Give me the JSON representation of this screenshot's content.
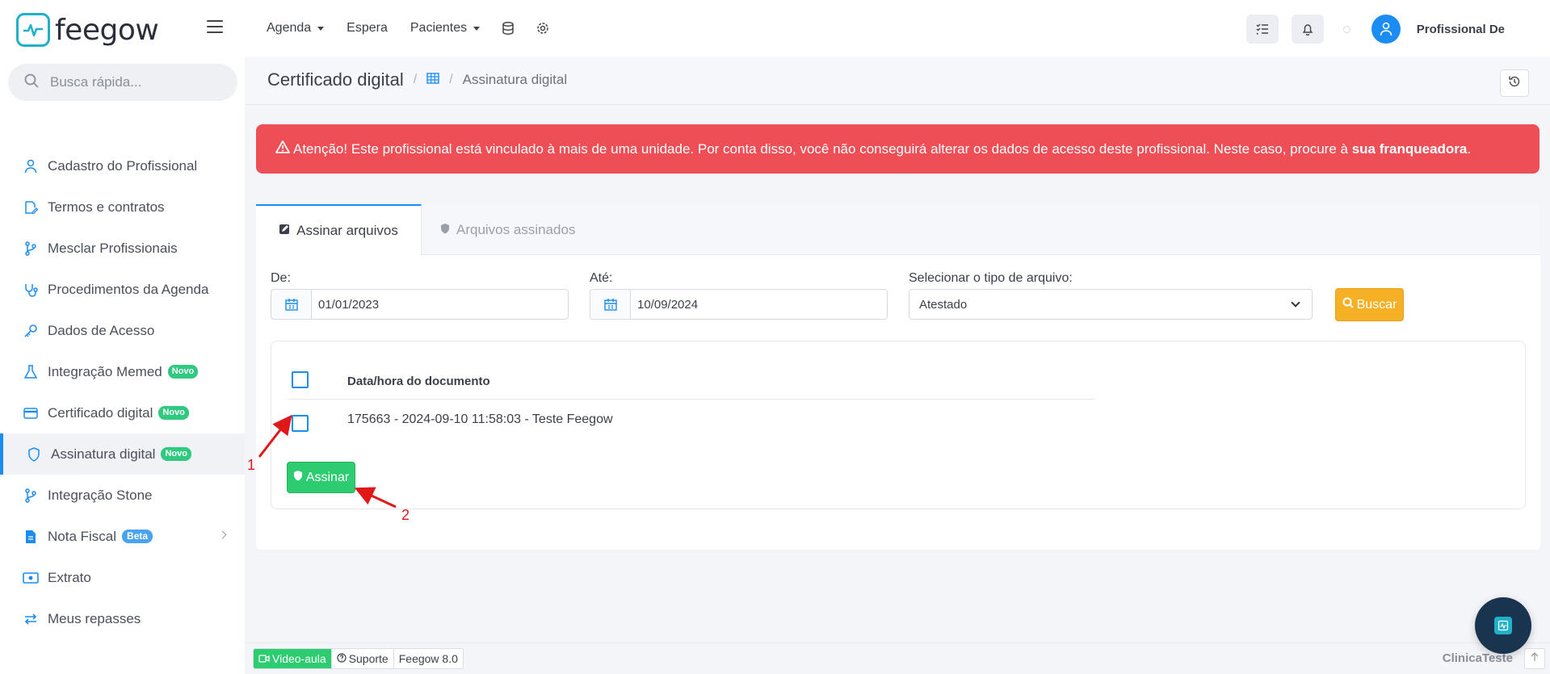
{
  "app": {
    "brand": "feegow"
  },
  "topnav": {
    "items": [
      {
        "label": "Agenda",
        "has_dropdown": true
      },
      {
        "label": "Espera",
        "has_dropdown": false
      },
      {
        "label": "Pacientes",
        "has_dropdown": true
      }
    ],
    "user": "Profissional De"
  },
  "search": {
    "placeholder": "Busca rápida..."
  },
  "sidebar": {
    "items": [
      {
        "label": "Cadastro do Profissional",
        "icon": "user-icon"
      },
      {
        "label": "Termos e contratos",
        "icon": "contract-icon"
      },
      {
        "label": "Mesclar Profissionais",
        "icon": "merge-icon"
      },
      {
        "label": "Procedimentos da Agenda",
        "icon": "stethoscope-icon"
      },
      {
        "label": "Dados de Acesso",
        "icon": "key-icon"
      },
      {
        "label": "Integração Memed",
        "icon": "flask-icon",
        "badge": "Novo"
      },
      {
        "label": "Certificado digital",
        "icon": "card-icon",
        "badge": "Novo"
      },
      {
        "label": "Assinatura digital",
        "icon": "shield-icon",
        "badge": "Novo",
        "active": true
      },
      {
        "label": "Integração Stone",
        "icon": "merge-icon"
      },
      {
        "label": "Nota Fiscal",
        "icon": "file-icon",
        "badge": "Beta",
        "has_submenu": true
      },
      {
        "label": "Extrato",
        "icon": "money-icon"
      },
      {
        "label": "Meus repasses",
        "icon": "transfer-icon"
      }
    ]
  },
  "breadcrumb": {
    "title": "Certificado digital",
    "separator": "/",
    "current": "Assinatura digital"
  },
  "alert": {
    "prefix": "Atenção! Este profissional está vinculado à mais de uma unidade. Por conta disso, você não conseguirá alterar os dados de acesso deste profissional. Neste caso, procure à",
    "bold": "sua franqueadora",
    "suffix": "."
  },
  "tabs": {
    "active": "Assinar arquivos",
    "inactive": "Arquivos assinados"
  },
  "filters": {
    "from_label": "De:",
    "from_value": "01/01/2023",
    "to_label": "Até:",
    "to_value": "10/09/2024",
    "type_label": "Selecionar o tipo de arquivo:",
    "type_value": "Atestado",
    "search_button": "Buscar"
  },
  "table": {
    "header": "Data/hora do documento",
    "rows": [
      {
        "label": "175663 - 2024-09-10 11:58:03 - Teste Feegow",
        "checked": false
      }
    ],
    "sign_button": "Assinar"
  },
  "annotations": {
    "first": "1",
    "second": "2"
  },
  "footer": {
    "video": "Video-aula",
    "support": "Suporte",
    "version": "Feegow 8.0",
    "clinic": "ClinicaTeste"
  },
  "colors": {
    "primary": "#1b8cf2",
    "alert": "#ee4e55",
    "success": "#2ecc71",
    "warning": "#f6b026",
    "brand": "#20b1c8"
  }
}
